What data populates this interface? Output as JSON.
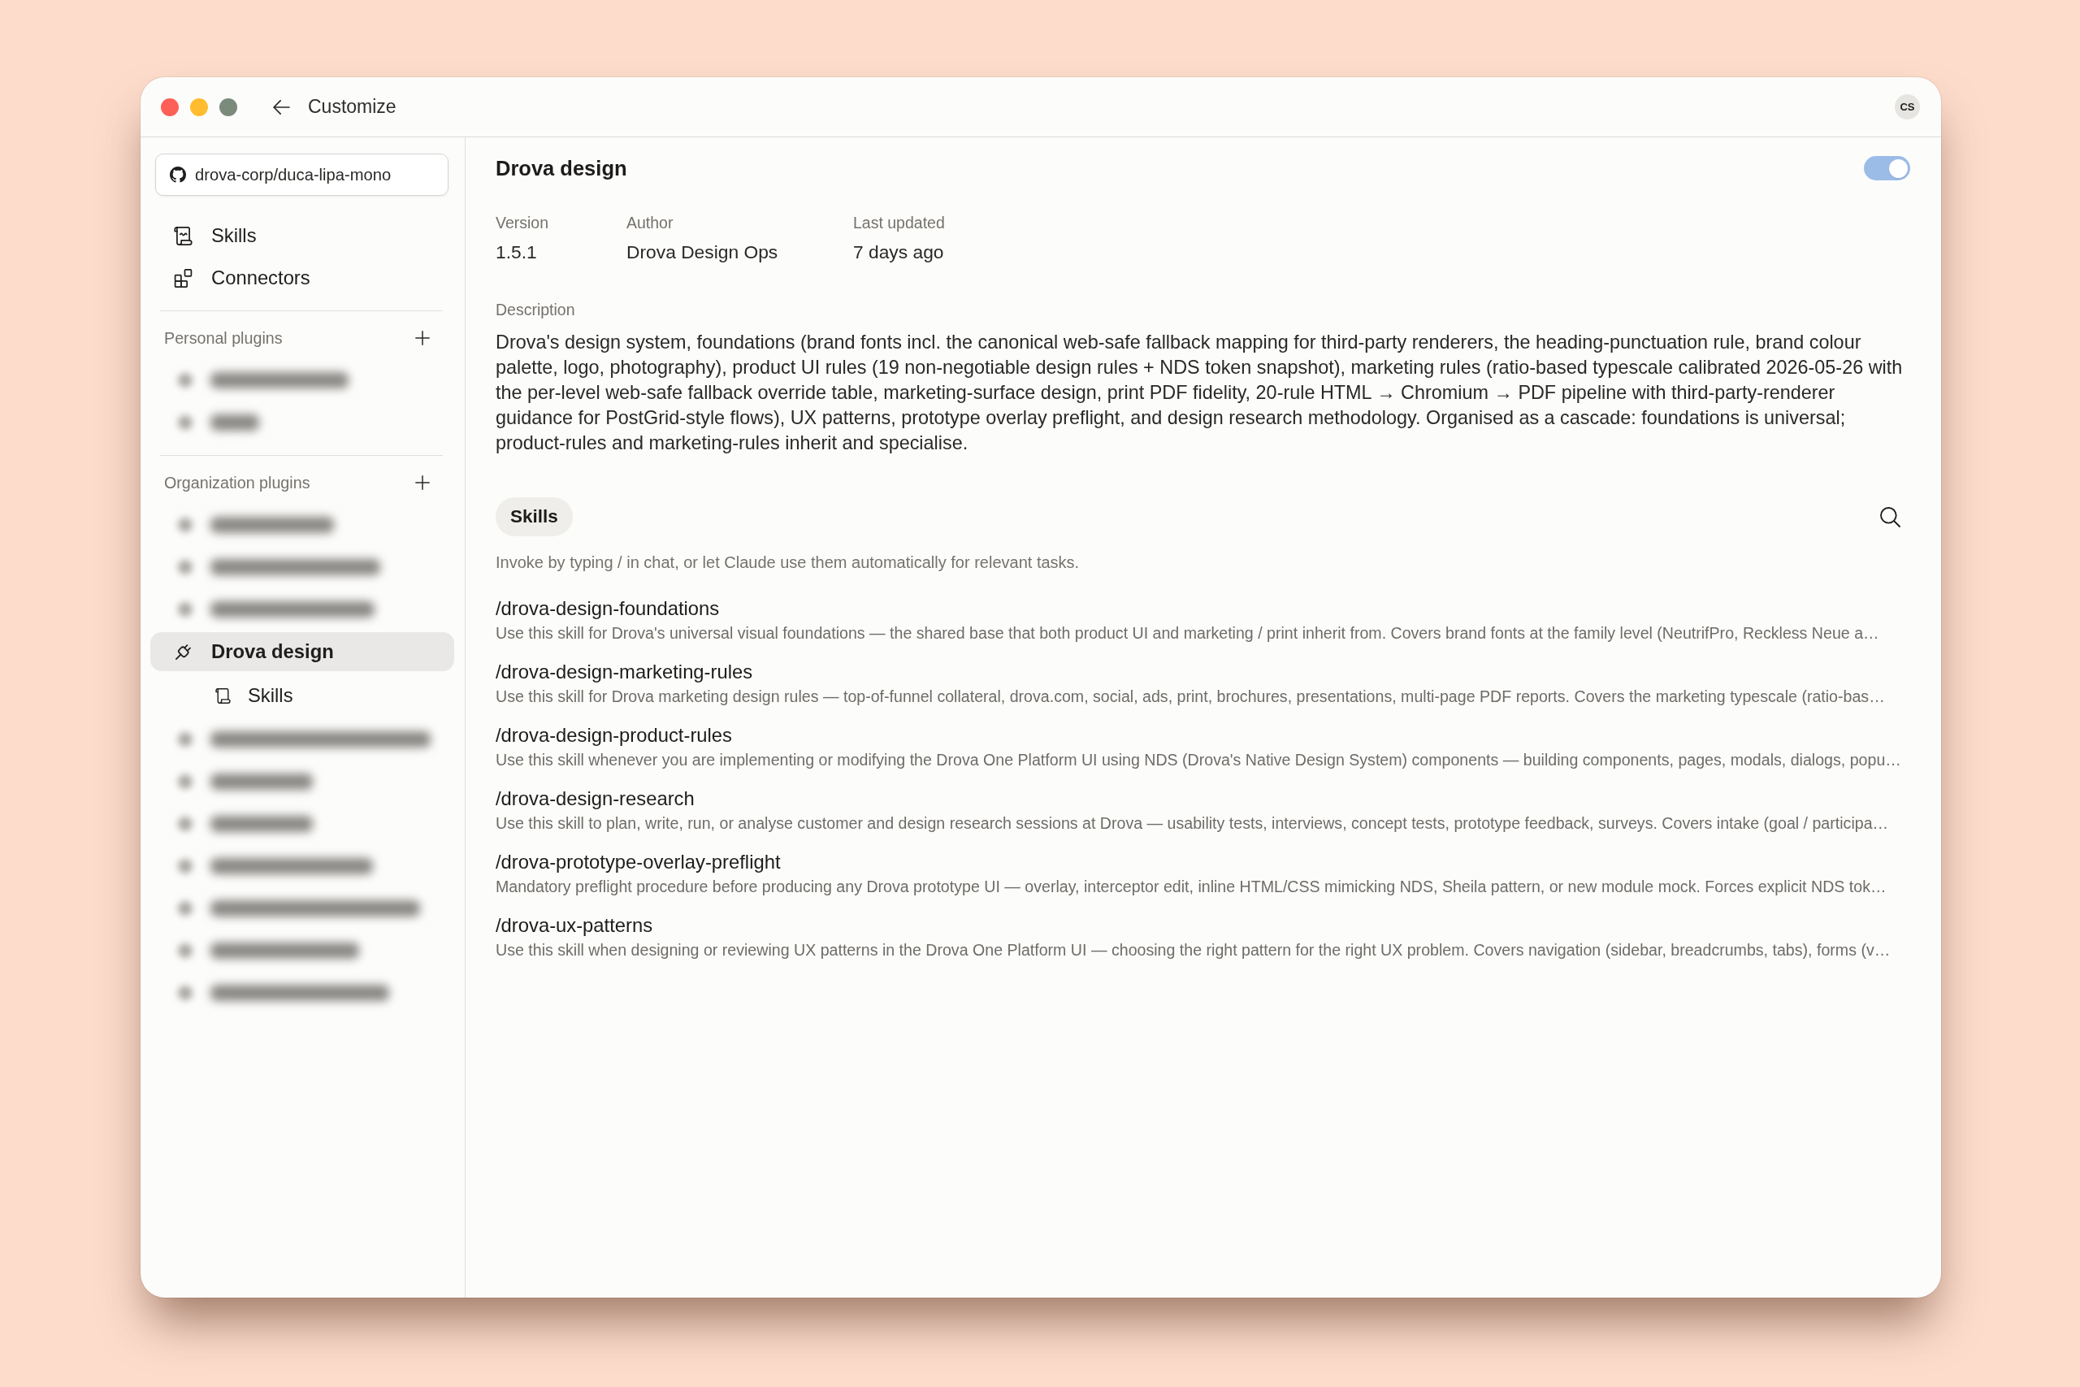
{
  "window": {
    "title": "Customize",
    "user_initials": "CS"
  },
  "sidebar": {
    "repository": "drova-corp/duca-lipa-mono",
    "nav": [
      {
        "kind": "skills",
        "label": "Skills",
        "selected": false
      },
      {
        "kind": "connectors",
        "label": "Connectors",
        "selected": false
      }
    ],
    "sections": [
      {
        "title": "Personal plugins",
        "items": [
          {
            "kind": "blurred",
            "selected": false
          },
          {
            "kind": "blurred",
            "selected": false
          }
        ]
      },
      {
        "title": "Organization plugins",
        "items": [
          {
            "kind": "blurred",
            "selected": false
          },
          {
            "kind": "blurred",
            "selected": false
          },
          {
            "kind": "blurred",
            "selected": false
          },
          {
            "kind": "plugin",
            "label": "Drova design",
            "selected": true,
            "children": [
              {
                "kind": "skills",
                "label": "Skills",
                "selected": false
              }
            ]
          },
          {
            "kind": "blurred",
            "selected": false
          },
          {
            "kind": "blurred",
            "selected": false
          },
          {
            "kind": "blurred",
            "selected": false
          },
          {
            "kind": "blurred",
            "selected": false
          },
          {
            "kind": "blurred",
            "selected": false
          },
          {
            "kind": "blurred",
            "selected": false
          },
          {
            "kind": "blurred",
            "selected": false
          }
        ]
      }
    ]
  },
  "plugin": {
    "title": "Drova design",
    "enabled": true,
    "meta": [
      {
        "label": "Version",
        "value": "1.5.1"
      },
      {
        "label": "Author",
        "value": "Drova Design Ops"
      },
      {
        "label": "Last updated",
        "value": "7 days ago"
      }
    ],
    "description_label": "Description",
    "description": "Drova's design system, foundations (brand fonts incl. the canonical web-safe fallback mapping for third-party renderers, the heading-punctuation rule, brand colour palette, logo, photography), product UI rules (19 non-negotiable design rules + NDS token snapshot), marketing rules (ratio-based typescale calibrated 2026-05-26 with the per-level web-safe fallback override table, marketing-surface design, print PDF fidelity, 20-rule HTML → Chromium → PDF pipeline with third-party-renderer guidance for PostGrid-style flows), UX patterns, prototype overlay preflight, and design research methodology. Organised as a cascade: foundations is universal; product-rules and marketing-rules inherit and specialise.",
    "tabs": [
      {
        "label": "Skills",
        "selected": true
      }
    ],
    "hint": "Invoke by typing / in chat, or let Claude use them automatically for relevant tasks.",
    "skills": [
      {
        "name": "/drova-design-foundations",
        "description": "Use this skill for Drova's universal visual foundations — the shared base that both product UI and marketing / print inherit from. Covers brand fonts at the family level (NeutrifPro, Reckless Neue a…"
      },
      {
        "name": "/drova-design-marketing-rules",
        "description": "Use this skill for Drova marketing design rules — top-of-funnel collateral, drova.com, social, ads, print, brochures, presentations, multi-page PDF reports. Covers the marketing typescale (ratio-bas…"
      },
      {
        "name": "/drova-design-product-rules",
        "description": "Use this skill whenever you are implementing or modifying the Drova One Platform UI using NDS (Drova's Native Design System) components — building components, pages, modals, dialogs, popu…"
      },
      {
        "name": "/drova-design-research",
        "description": "Use this skill to plan, write, run, or analyse customer and design research sessions at Drova — usability tests, interviews, concept tests, prototype feedback, surveys. Covers intake (goal / participa…"
      },
      {
        "name": "/drova-prototype-overlay-preflight",
        "description": "Mandatory preflight procedure before producing any Drova prototype UI — overlay, interceptor edit, inline HTML/CSS mimicking NDS, Sheila pattern, or new module mock. Forces explicit NDS tok…"
      },
      {
        "name": "/drova-ux-patterns",
        "description": "Use this skill when designing or reviewing UX patterns in the Drova One Platform UI — choosing the right pattern for the right UX problem. Covers navigation (sidebar, breadcrumbs, tabs), forms (v…"
      }
    ]
  }
}
